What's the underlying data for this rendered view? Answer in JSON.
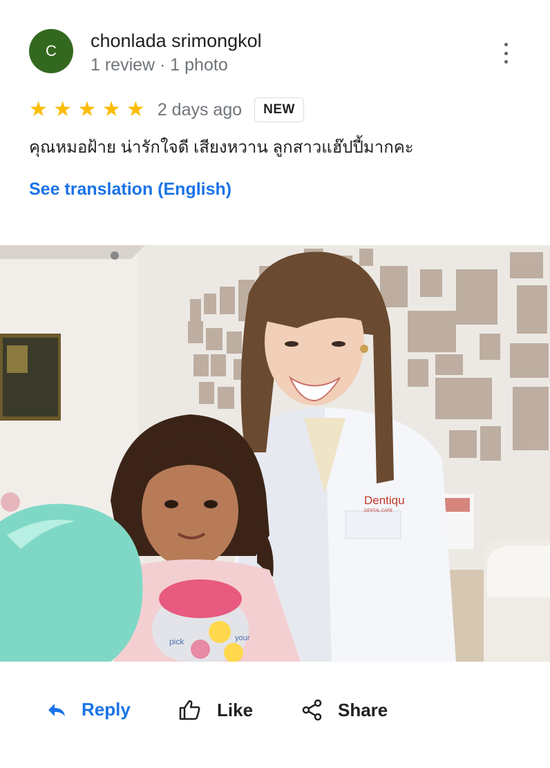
{
  "review": {
    "avatar_letter": "C",
    "avatar_color": "#33691e",
    "author": "chonlada srimongkol",
    "meta": "1 review · 1 photo",
    "rating": 5,
    "stars": "★ ★ ★ ★ ★",
    "date": "2 days ago",
    "badge": "NEW",
    "text": "คุณหมอฝ้าย น่ารักใจดี เสียงหวาน ลูกสาวแฮ๊ปปี้มากคะ",
    "translate_link": "See translation (English)"
  },
  "photo": {
    "clinic_logo_text": "Dentiqu",
    "clinic_logo_sub": "DENTAL CARE",
    "jar_label_1": "pick",
    "jar_label_2": "your"
  },
  "actions": {
    "reply": "Reply",
    "like": "Like",
    "share": "Share"
  },
  "colors": {
    "accent": "#1a73e8",
    "star": "#fbbc04",
    "meta_text": "#70757a"
  },
  "icons": {
    "more": "more-vert-icon",
    "reply": "reply-icon",
    "like": "thumb-up-icon",
    "share": "share-icon"
  }
}
